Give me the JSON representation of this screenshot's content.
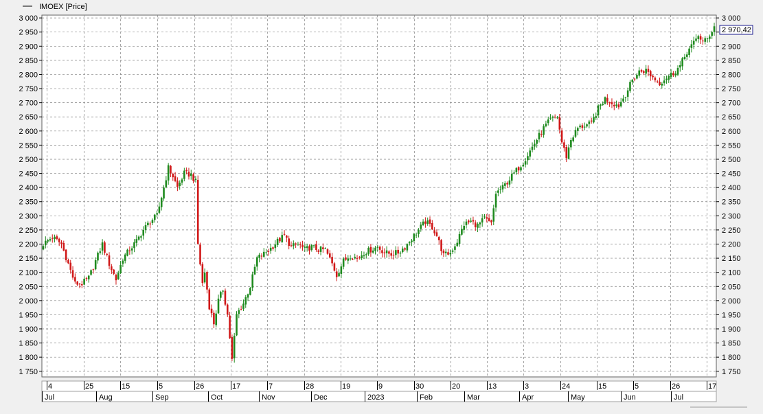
{
  "legend": {
    "label": "IMOEX [Price]"
  },
  "last_price_label": "2 970,42",
  "colors": {
    "up": "#1e8a1e",
    "down": "#d01818",
    "grid": "#808080",
    "plot_bg": "#ffffff",
    "frame_bg": "#f0f0f0",
    "last_box": "#1a1a8c"
  },
  "chart_data": {
    "type": "candlestick",
    "ylim": [
      1730,
      3010
    ],
    "y_ticks": [
      1750,
      1800,
      1850,
      1900,
      1950,
      2000,
      2050,
      2100,
      2150,
      2200,
      2250,
      2300,
      2350,
      2400,
      2450,
      2500,
      2550,
      2600,
      2650,
      2700,
      2750,
      2800,
      2850,
      2900,
      2950,
      3000
    ],
    "y_tick_labels": [
      "1 750",
      "1 800",
      "1 850",
      "1 900",
      "1 950",
      "2 000",
      "2 050",
      "2 100",
      "2 150",
      "2 200",
      "2 250",
      "2 300",
      "2 350",
      "2 400",
      "2 450",
      "2 500",
      "2 550",
      "2 600",
      "2 650",
      "2 700",
      "2 750",
      "2 800",
      "2 850",
      "2 900",
      "2 950",
      "3 000"
    ],
    "x_day_ticks": [
      "4",
      "25",
      "15",
      "5",
      "26",
      "17",
      "7",
      "28",
      "19",
      "9",
      "30",
      "20",
      "13",
      "3",
      "24",
      "15",
      "5",
      "26",
      "17"
    ],
    "x_month_labels": [
      "Jul",
      "Aug",
      "Sep",
      "Oct",
      "Nov",
      "Dec",
      "2023",
      "Feb",
      "Mar",
      "Apr",
      "May",
      "Jun",
      "Jul"
    ],
    "last_value": 2970.42,
    "anchors": [
      [
        0,
        2200
      ],
      [
        4,
        2225
      ],
      [
        8,
        2200
      ],
      [
        11,
        2130
      ],
      [
        14,
        2060
      ],
      [
        17,
        2060
      ],
      [
        20,
        2080
      ],
      [
        23,
        2140
      ],
      [
        26,
        2200
      ],
      [
        29,
        2130
      ],
      [
        32,
        2075
      ],
      [
        35,
        2150
      ],
      [
        38,
        2180
      ],
      [
        41,
        2210
      ],
      [
        44,
        2250
      ],
      [
        47,
        2280
      ],
      [
        50,
        2300
      ],
      [
        53,
        2400
      ],
      [
        55,
        2470
      ],
      [
        57,
        2440
      ],
      [
        59,
        2400
      ],
      [
        62,
        2450
      ],
      [
        65,
        2445
      ],
      [
        67,
        2420
      ],
      [
        68,
        2200
      ],
      [
        70,
        2060
      ],
      [
        71,
        2100
      ],
      [
        73,
        1980
      ],
      [
        75,
        1920
      ],
      [
        77,
        2000
      ],
      [
        79,
        2040
      ],
      [
        81,
        1950
      ],
      [
        83,
        1790
      ],
      [
        85,
        1950
      ],
      [
        88,
        1990
      ],
      [
        91,
        2050
      ],
      [
        94,
        2150
      ],
      [
        97,
        2165
      ],
      [
        100,
        2185
      ],
      [
        103,
        2210
      ],
      [
        106,
        2230
      ],
      [
        109,
        2190
      ],
      [
        112,
        2200
      ],
      [
        115,
        2180
      ],
      [
        118,
        2190
      ],
      [
        121,
        2180
      ],
      [
        124,
        2180
      ],
      [
        127,
        2130
      ],
      [
        129,
        2090
      ],
      [
        132,
        2140
      ],
      [
        135,
        2160
      ],
      [
        138,
        2150
      ],
      [
        141,
        2170
      ],
      [
        144,
        2180
      ],
      [
        147,
        2190
      ],
      [
        150,
        2170
      ],
      [
        153,
        2165
      ],
      [
        156,
        2170
      ],
      [
        159,
        2190
      ],
      [
        162,
        2220
      ],
      [
        165,
        2250
      ],
      [
        168,
        2280
      ],
      [
        171,
        2260
      ],
      [
        173,
        2230
      ],
      [
        176,
        2160
      ],
      [
        179,
        2170
      ],
      [
        182,
        2210
      ],
      [
        185,
        2270
      ],
      [
        188,
        2280
      ],
      [
        191,
        2265
      ],
      [
        194,
        2290
      ],
      [
        197,
        2270
      ],
      [
        199,
        2380
      ],
      [
        202,
        2400
      ],
      [
        205,
        2430
      ],
      [
        208,
        2460
      ],
      [
        211,
        2490
      ],
      [
        214,
        2530
      ],
      [
        217,
        2570
      ],
      [
        220,
        2610
      ],
      [
        223,
        2640
      ],
      [
        226,
        2650
      ],
      [
        228,
        2560
      ],
      [
        230,
        2510
      ],
      [
        232,
        2570
      ],
      [
        235,
        2610
      ],
      [
        238,
        2620
      ],
      [
        241,
        2625
      ],
      [
        244,
        2680
      ],
      [
        247,
        2715
      ],
      [
        250,
        2700
      ],
      [
        253,
        2690
      ],
      [
        256,
        2730
      ],
      [
        259,
        2780
      ],
      [
        262,
        2810
      ],
      [
        265,
        2815
      ],
      [
        268,
        2790
      ],
      [
        271,
        2770
      ],
      [
        274,
        2790
      ],
      [
        277,
        2805
      ],
      [
        280,
        2830
      ],
      [
        283,
        2880
      ],
      [
        286,
        2910
      ],
      [
        288,
        2940
      ],
      [
        290,
        2915
      ],
      [
        292,
        2925
      ],
      [
        295,
        2970
      ]
    ]
  }
}
